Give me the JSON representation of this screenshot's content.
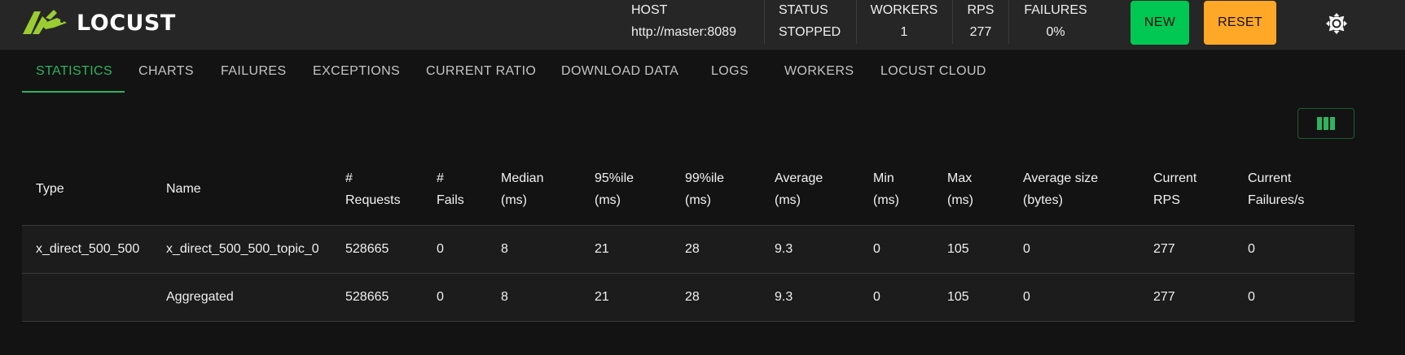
{
  "app": {
    "logo_text": "LOCUST",
    "brand_color": "#9acd32"
  },
  "header": {
    "host": {
      "label": "HOST",
      "value": "http://master:8089"
    },
    "status": {
      "label": "STATUS",
      "value": "STOPPED"
    },
    "workers": {
      "label": "WORKERS",
      "value": "1"
    },
    "rps": {
      "label": "RPS",
      "value": "277"
    },
    "failures": {
      "label": "FAILURES",
      "value": "0%"
    },
    "new_button": "NEW",
    "reset_button": "RESET",
    "theme_icon": "brightness-icon"
  },
  "tabs": [
    {
      "label": "STATISTICS",
      "active": true
    },
    {
      "label": "CHARTS"
    },
    {
      "label": "FAILURES"
    },
    {
      "label": "EXCEPTIONS"
    },
    {
      "label": "CURRENT RATIO"
    },
    {
      "label": "DOWNLOAD DATA"
    },
    {
      "label": "LOGS"
    },
    {
      "label": "WORKERS"
    },
    {
      "label": "LOCUST CLOUD"
    }
  ],
  "colors": {
    "active_tab": "#2eb360",
    "new_button": "#00c853",
    "reset_button": "#ffa726"
  },
  "table": {
    "column_selector_icon": "view-columns-icon",
    "headers": [
      "Type",
      "Name",
      "#\nRequests",
      "#\nFails",
      "Median\n(ms)",
      "95%ile\n(ms)",
      "99%ile\n(ms)",
      "Average\n(ms)",
      "Min\n(ms)",
      "Max\n(ms)",
      "Average size\n(bytes)",
      "Current\nRPS",
      "Current\nFailures/s"
    ],
    "rows": [
      [
        "x_direct_500_500",
        "x_direct_500_500_topic_0",
        "528665",
        "0",
        "8",
        "21",
        "28",
        "9.3",
        "0",
        "105",
        "0",
        "277",
        "0"
      ],
      [
        "",
        "Aggregated",
        "528665",
        "0",
        "8",
        "21",
        "28",
        "9.3",
        "0",
        "105",
        "0",
        "277",
        "0"
      ]
    ]
  }
}
